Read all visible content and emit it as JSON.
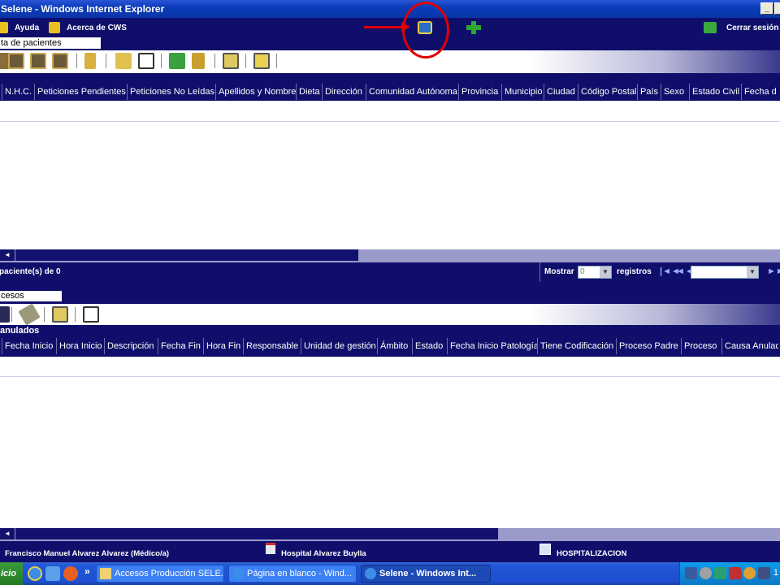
{
  "window": {
    "title": "Selene - Windows Internet Explorer",
    "minimize": "_",
    "close": "X"
  },
  "menu": {
    "help": "Ayuda",
    "about": "Acerca de CWS",
    "logout": "Cerrar sesión"
  },
  "patients": {
    "tab_label": "ta de pacientes",
    "columns": [
      "N.H.C.",
      "Peticiones Pendientes",
      "Peticiones No Leídas",
      "Apellidos y Nombre",
      "Dieta",
      "Dirección",
      "Comunidad Autónoma",
      "Provincia",
      "Municipio",
      "Ciudad",
      "Código Postal",
      "País",
      "Sexo",
      "Estado Civil",
      "Fecha d"
    ],
    "count_text": "paciente(s) de 0",
    "show_label": "Mostrar",
    "show_value": "0",
    "records_label": "registros",
    "nav_first": "|◄◄",
    "nav_prev": "◄◄",
    "nav_next": "►►"
  },
  "processes": {
    "tab_label": "cesos",
    "section_label": "anulados",
    "columns": [
      "Fecha Inicio",
      "Hora Inicio",
      "Descripción",
      "Fecha Fin",
      "Hora Fin",
      "Responsable",
      "Unidad de gestión",
      "Ámbito",
      "Estado",
      "Fecha Inicio Patología",
      "Tiene Codificación",
      "Proceso Padre",
      "Proceso",
      "Causa Anulac"
    ]
  },
  "status": {
    "user": "Francisco Manuel Alvarez Alvarez (Médico/a)",
    "hospital": "Hospital Alvarez Buylla",
    "unit": "HOSPITALIZACION"
  },
  "taskbar": {
    "start": "icio",
    "more": "»",
    "tasks": [
      "Accesos Producción SELE...",
      "Página en blanco - Wind...",
      "Selene - Windows Int..."
    ],
    "clock": "1"
  },
  "colors": {
    "navy": "#0f0f6b",
    "lilac": "#9b9bcb",
    "annotation": "#e00000"
  }
}
